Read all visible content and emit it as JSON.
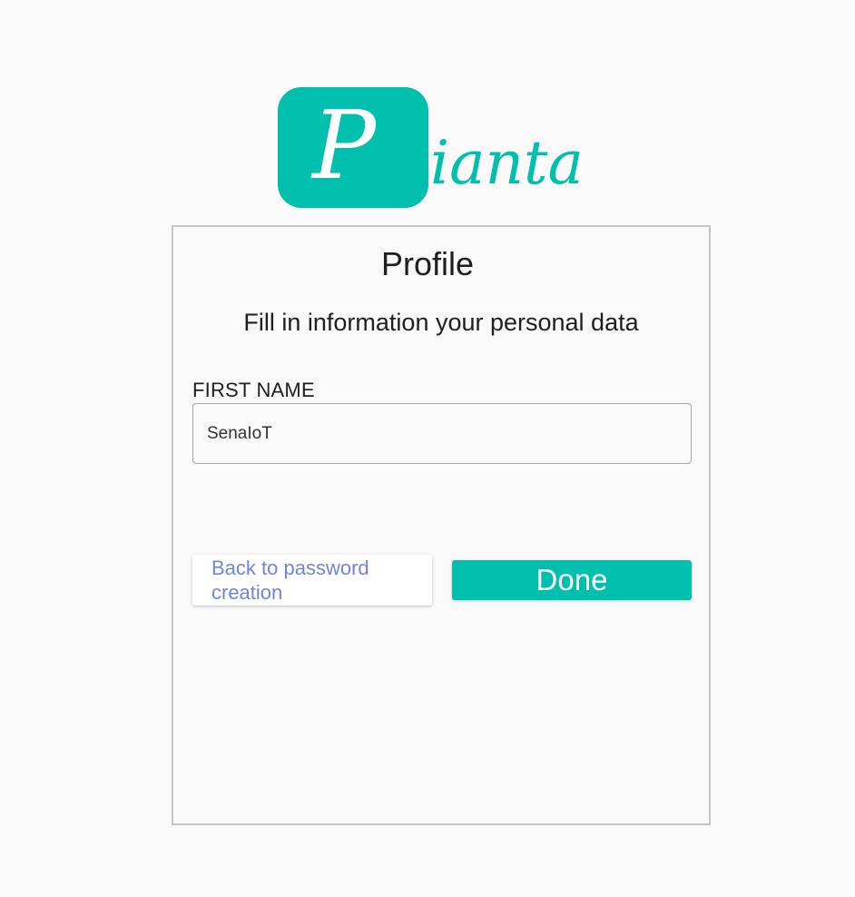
{
  "logo": {
    "letter": "P",
    "text": "ianta",
    "color": "#00bfad"
  },
  "profile": {
    "title": "Profile",
    "subtitle": "Fill in information your personal data",
    "first_name": {
      "label": "FIRST NAME",
      "value": "SenaIoT"
    },
    "back_button_label": "Back to password creation",
    "done_button_label": "Done"
  },
  "colors": {
    "brand": "#00bfad",
    "link": "#6f84e0",
    "background": "#f9f9f9"
  }
}
